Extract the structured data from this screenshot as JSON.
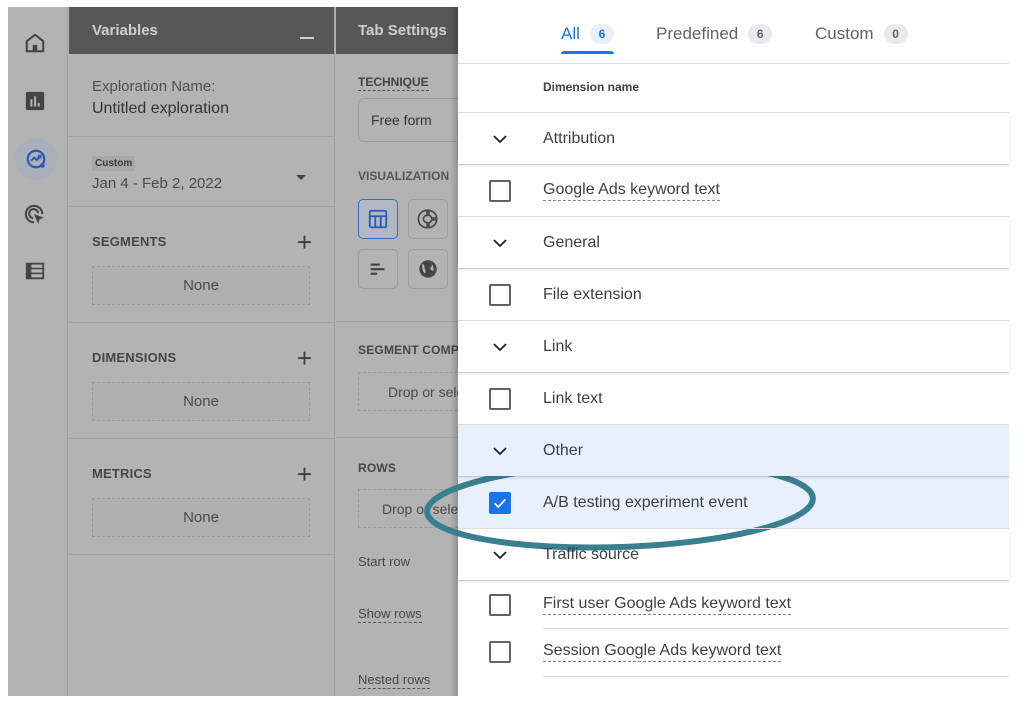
{
  "rail": {
    "icons": [
      "home-icon",
      "reports-icon",
      "explore-icon",
      "advertising-icon",
      "configure-icon"
    ],
    "active": "explore-icon"
  },
  "variables": {
    "title": "Variables",
    "exploration_name_label": "Exploration Name:",
    "exploration_name_value": "Untitled exploration",
    "date_chip": "Custom",
    "date_range": "Jan 4 - Feb 2, 2022",
    "sections": [
      {
        "title": "SEGMENTS",
        "value": "None"
      },
      {
        "title": "DIMENSIONS",
        "value": "None"
      },
      {
        "title": "METRICS",
        "value": "None"
      }
    ]
  },
  "tab_settings": {
    "title": "Tab Settings",
    "technique_label": "TECHNIQUE",
    "technique_value": "Free form",
    "visualization_label": "VISUALIZATION",
    "visualizations": [
      "table",
      "donut-chart",
      "bar-chart",
      "geo-map"
    ],
    "active_visualization": "table",
    "segment_comparisons_label": "SEGMENT COMPARISONS",
    "segment_drop_placeholder": "Drop or select segment",
    "rows_label": "ROWS",
    "rows_drop_placeholder": "Drop or select dimension",
    "start_row_label": "Start row",
    "show_rows_label": "Show rows",
    "nested_rows_label": "Nested rows"
  },
  "picker": {
    "tabs": [
      {
        "label": "All",
        "count": "6",
        "active": true
      },
      {
        "label": "Predefined",
        "count": "6",
        "active": false
      },
      {
        "label": "Custom",
        "count": "0",
        "active": false
      }
    ],
    "column_header": "Dimension name",
    "rows": [
      {
        "type": "group",
        "label": "Attribution"
      },
      {
        "type": "item",
        "label": "Google Ads keyword text",
        "checked": false,
        "dashed": true
      },
      {
        "type": "group",
        "label": "General"
      },
      {
        "type": "item",
        "label": "File extension",
        "checked": false,
        "dashed": false
      },
      {
        "type": "group",
        "label": "Link"
      },
      {
        "type": "item",
        "label": "Link text",
        "checked": false,
        "dashed": false
      },
      {
        "type": "group",
        "label": "Other",
        "highlighted": true
      },
      {
        "type": "item",
        "label": "A/B testing experiment event",
        "checked": true,
        "dashed": false,
        "highlighted": true
      },
      {
        "type": "group",
        "label": "Traffic source"
      },
      {
        "type": "item",
        "label": "First user Google Ads keyword text",
        "checked": false,
        "dashed": true
      },
      {
        "type": "item",
        "label": "Session Google Ads keyword text",
        "checked": false,
        "dashed": true
      }
    ]
  },
  "annotation": {
    "shape": "ellipse",
    "target": "A/B testing experiment event",
    "color": "#3a7f8f"
  },
  "colors": {
    "accent": "#1a73e8",
    "highlight_row": "#e8f0fe",
    "dim_overlay": "#b3b3b3"
  }
}
